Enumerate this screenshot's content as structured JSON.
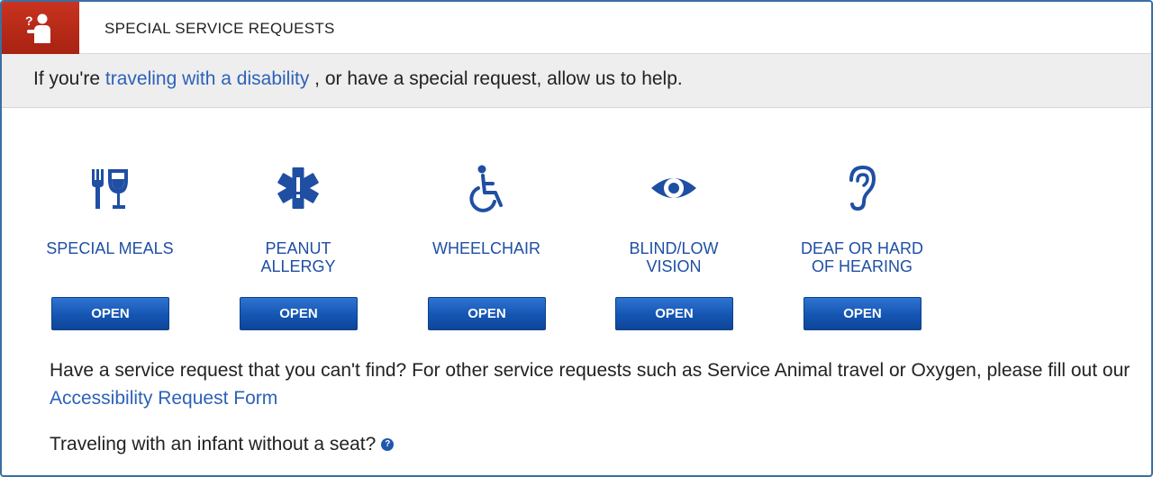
{
  "header": {
    "icon": "person-question-icon",
    "title": "SPECIAL SERVICE REQUESTS",
    "accent_color": "#b72a17"
  },
  "intro": {
    "prefix": "If you're ",
    "link": "traveling with a disability",
    "suffix": " , or have a special request, allow us to help."
  },
  "services": [
    {
      "icon": "fork-wine-glass-icon",
      "label_line1": "SPECIAL MEALS",
      "label_line2": "",
      "button": "OPEN"
    },
    {
      "icon": "medical-star-icon",
      "label_line1": "PEANUT",
      "label_line2": "ALLERGY",
      "button": "OPEN"
    },
    {
      "icon": "wheelchair-icon",
      "label_line1": "WHEELCHAIR",
      "label_line2": "",
      "button": "OPEN"
    },
    {
      "icon": "eye-icon",
      "label_line1": "BLIND/LOW",
      "label_line2": "VISION",
      "button": "OPEN"
    },
    {
      "icon": "ear-icon",
      "label_line1": "DEAF OR HARD",
      "label_line2": "OF HEARING",
      "button": "OPEN"
    }
  ],
  "other": {
    "text": "Have a service request that you can't find? For other service requests such as Service Animal travel or Oxygen, please fill out our ",
    "link": "Accessibility Request Form"
  },
  "infant": {
    "text": "Traveling with an infant without a seat?",
    "help_icon": "question-circle-icon",
    "help_glyph": "?"
  },
  "colors": {
    "brand_blue": "#1f4fa3",
    "link_blue": "#2d62b9",
    "button_blue": "#1555b3"
  }
}
